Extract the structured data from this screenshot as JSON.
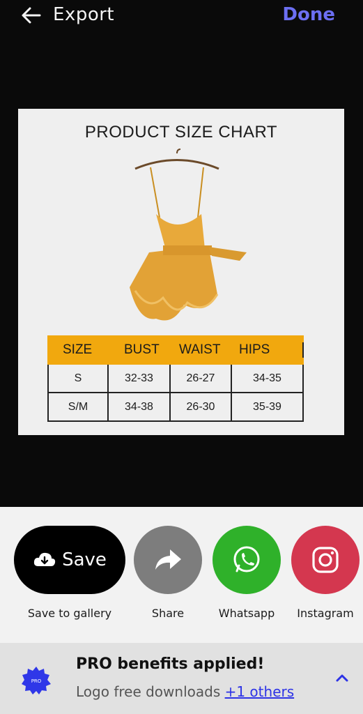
{
  "header": {
    "title": "Export",
    "done_label": "Done",
    "back_icon": "arrow-left-icon"
  },
  "preview": {
    "chart_title": "PRODUCT SIZE CHART",
    "garment_image": "yellow-romper-on-hanger",
    "table": {
      "headers": [
        "SIZE",
        "BUST",
        "WAIST",
        "HIPS"
      ],
      "rows": [
        [
          "S",
          "32-33",
          "26-27",
          "34-35"
        ],
        [
          "S/M",
          "34-38",
          "26-30",
          "35-39"
        ]
      ],
      "header_color": "#f1a80e"
    }
  },
  "share": {
    "save_label": "Save",
    "options": [
      {
        "label": "Save to gallery",
        "icon": "cloud-download-icon"
      },
      {
        "label": "Share",
        "icon": "share-arrow-icon"
      },
      {
        "label": "Whatsapp",
        "icon": "whatsapp-icon"
      },
      {
        "label": "Instagram",
        "icon": "instagram-icon"
      }
    ]
  },
  "pro": {
    "badge_text": "PRO",
    "title": "PRO benefits applied!",
    "subtitle": "Logo free downloads ",
    "link": "+1 others",
    "chevron_icon": "chevron-up-icon"
  },
  "colors": {
    "accent": "#6c6ff2",
    "whatsapp": "#2fb12a",
    "instagram": "#d4374f",
    "share": "#7d7d7d",
    "link": "#2d33e6"
  }
}
